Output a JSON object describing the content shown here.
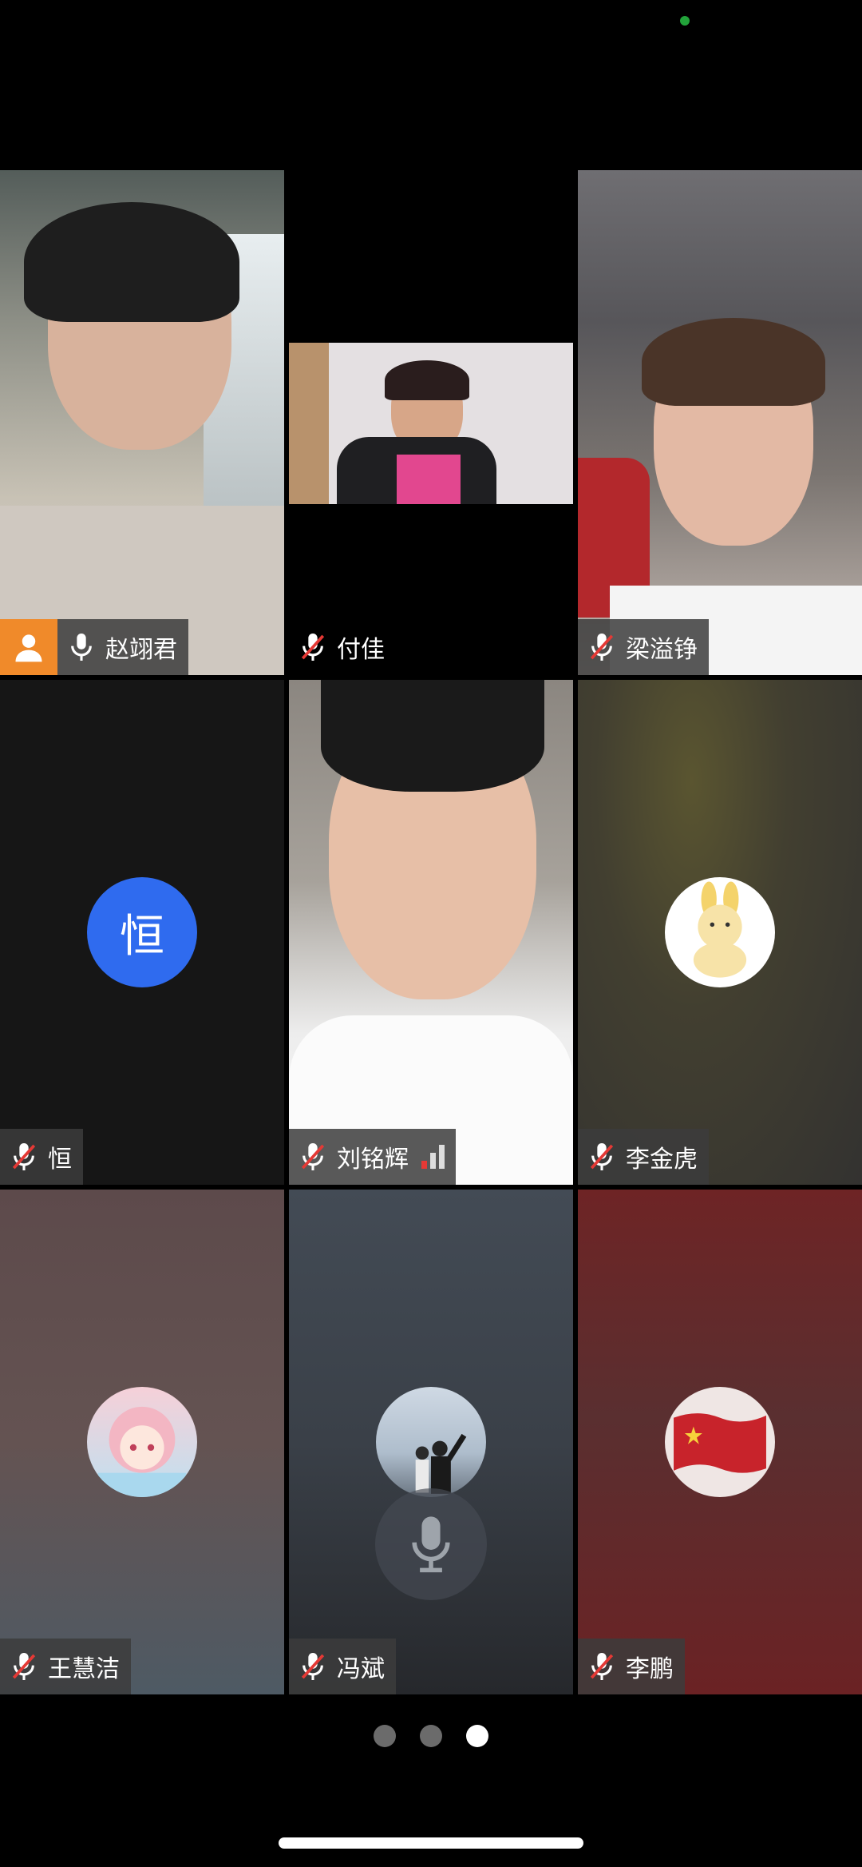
{
  "participants": [
    {
      "name": "赵翊君",
      "mic": "on"
    },
    {
      "name": "付佳",
      "mic": "muted"
    },
    {
      "name": "梁溢铮",
      "mic": "muted"
    },
    {
      "name": "恒",
      "mic": "muted",
      "avatar_letter": "恒"
    },
    {
      "name": "刘铭辉",
      "mic": "muted"
    },
    {
      "name": "李金虎",
      "mic": "muted"
    },
    {
      "name": "王慧洁",
      "mic": "muted"
    },
    {
      "name": "冯斌",
      "mic": "muted"
    },
    {
      "name": "李鹏",
      "mic": "muted"
    }
  ],
  "pager": {
    "pages": 3,
    "current": 3
  },
  "colors": {
    "letter_avatar": "#2f6bef",
    "host_badge": "#f08a2a",
    "status_dot": "#22a33a"
  }
}
